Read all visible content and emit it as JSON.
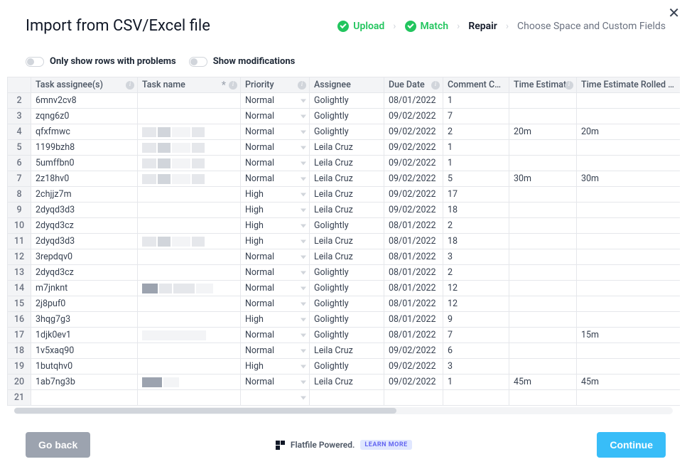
{
  "title": "Import from CSV/Excel file",
  "steps": {
    "upload": "Upload",
    "match": "Match",
    "repair": "Repair",
    "choose": "Choose Space and Custom Fields"
  },
  "filters": {
    "problems": "Only show rows with problems",
    "modifications": "Show modifications"
  },
  "columns": {
    "task_assignees": "Task assignee(s)",
    "task_name": "Task name",
    "priority": "Priority",
    "assignee": "Assignee",
    "due_date": "Due Date",
    "comment_count": "Comment Count",
    "time_estimate": "Time Estimate",
    "time_rolled": "Time Estimate Rolled Up"
  },
  "rows": [
    {
      "n": 2,
      "assignees": "6mnv2cv8",
      "task_blur": "none",
      "priority": "Normal",
      "assignee": "Golightly",
      "due": "08/01/2022",
      "comments": "1",
      "time": "",
      "rolled": ""
    },
    {
      "n": 3,
      "assignees": "zqng6z0",
      "task_blur": "none",
      "priority": "Normal",
      "assignee": "Golightly",
      "due": "09/02/2022",
      "comments": "7",
      "time": "",
      "rolled": ""
    },
    {
      "n": 4,
      "assignees": "qfxfmwc",
      "task_blur": "mix",
      "priority": "Normal",
      "assignee": "Golightly",
      "due": "09/02/2022",
      "comments": "2",
      "time": "20m",
      "rolled": "20m"
    },
    {
      "n": 5,
      "assignees": "1199bzh8",
      "task_blur": "mix",
      "priority": "Normal",
      "assignee": "Leila Cruz",
      "due": "09/02/2022",
      "comments": "1",
      "time": "",
      "rolled": ""
    },
    {
      "n": 6,
      "assignees": "5umffbn0",
      "task_blur": "mix",
      "priority": "Normal",
      "assignee": "Leila Cruz",
      "due": "09/02/2022",
      "comments": "1",
      "time": "",
      "rolled": ""
    },
    {
      "n": 7,
      "assignees": "2z18hv0",
      "task_blur": "mix",
      "priority": "Normal",
      "assignee": "Leila Cruz",
      "due": "09/02/2022",
      "comments": "5",
      "time": "30m",
      "rolled": "30m"
    },
    {
      "n": 8,
      "assignees": "2chjjz7m",
      "task_blur": "none",
      "priority": "High",
      "assignee": "Leila Cruz",
      "due": "09/02/2022",
      "comments": "17",
      "time": "",
      "rolled": ""
    },
    {
      "n": 9,
      "assignees": "2dyqd3d3",
      "task_blur": "none",
      "priority": "High",
      "assignee": "Leila Cruz",
      "due": "09/02/2022",
      "comments": "18",
      "time": "",
      "rolled": ""
    },
    {
      "n": 10,
      "assignees": "2dyqd3cz",
      "task_blur": "none",
      "priority": "High",
      "assignee": "Golightly",
      "due": "08/01/2022",
      "comments": "2",
      "time": "",
      "rolled": ""
    },
    {
      "n": 11,
      "assignees": "2dyqd3d3",
      "task_blur": "mix",
      "priority": "High",
      "assignee": "Leila Cruz",
      "due": "08/01/2022",
      "comments": "18",
      "time": "",
      "rolled": ""
    },
    {
      "n": 12,
      "assignees": "3repdqv0",
      "task_blur": "none",
      "priority": "Normal",
      "assignee": "Leila Cruz",
      "due": "08/01/2022",
      "comments": "3",
      "time": "",
      "rolled": ""
    },
    {
      "n": 13,
      "assignees": "2dyqd3cz",
      "task_blur": "none",
      "pri_bar": true,
      "priority": "Normal",
      "assignee": "Golightly",
      "due": "08/01/2022",
      "comments": "2",
      "time": "",
      "rolled": ""
    },
    {
      "n": 14,
      "assignees": "m7jnknt",
      "task_blur": "dark",
      "pri_bar": true,
      "priority": "Normal",
      "assignee": "Golightly",
      "due": "08/01/2022",
      "comments": "12",
      "time": "",
      "rolled": ""
    },
    {
      "n": 15,
      "assignees": "2j8puf0",
      "task_blur": "none",
      "priority": "Normal",
      "assignee": "Golightly",
      "due": "08/01/2022",
      "comments": "12",
      "time": "",
      "rolled": ""
    },
    {
      "n": 16,
      "assignees": "3hqg7g3",
      "task_blur": "none",
      "priority": "High",
      "assignee": "Golightly",
      "due": "08/01/2022",
      "comments": "9",
      "time": "",
      "rolled": ""
    },
    {
      "n": 17,
      "assignees": "1djk0ev1",
      "task_blur": "light",
      "priority": "Normal",
      "assignee": "Golightly",
      "due": "08/01/2022",
      "comments": "7",
      "time": "",
      "rolled": "15m"
    },
    {
      "n": 18,
      "assignees": "1v5xaq90",
      "task_blur": "none",
      "priority": "Normal",
      "assignee": "Leila Cruz",
      "due": "09/02/2022",
      "comments": "6",
      "time": "",
      "rolled": ""
    },
    {
      "n": 19,
      "assignees": "1butqhv0",
      "task_blur": "none",
      "priority": "High",
      "assignee": "Golightly",
      "due": "09/02/2022",
      "comments": "3",
      "time": "",
      "rolled": ""
    },
    {
      "n": 20,
      "assignees": "1ab7ng3b",
      "task_blur": "dark2",
      "pri_bar": true,
      "priority": "Normal",
      "assignee": "Leila Cruz",
      "due": "09/02/2022",
      "comments": "1",
      "time": "45m",
      "rolled": "45m"
    },
    {
      "n": 21,
      "assignees": "",
      "task_blur": "none",
      "priority": "",
      "assignee": "",
      "due": "",
      "comments": "",
      "time": "",
      "rolled": ""
    }
  ],
  "footer": {
    "back": "Go back",
    "continue": "Continue",
    "powered": "Flatfile Powered.",
    "learn": "LEARN MORE"
  }
}
